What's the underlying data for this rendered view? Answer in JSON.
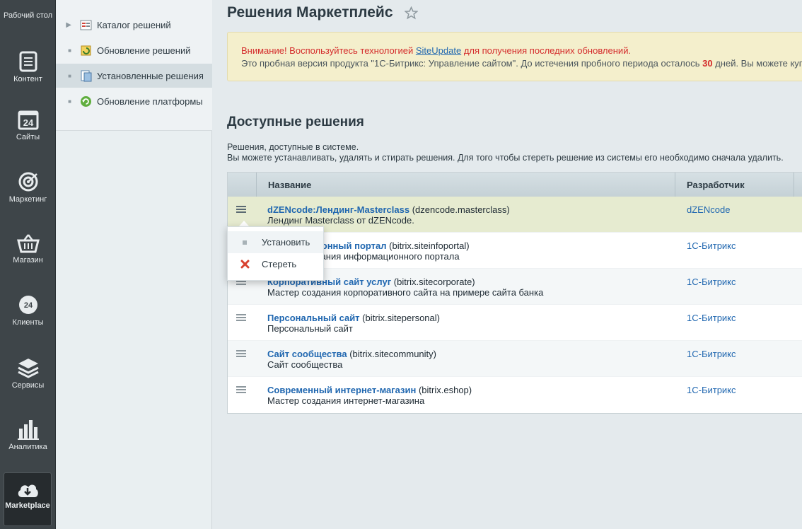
{
  "leftbar": {
    "items": [
      {
        "label": "Рабочий стол",
        "icon": "desktop-icon"
      },
      {
        "label": "Контент",
        "icon": "content-icon"
      },
      {
        "label": "Сайты",
        "icon": "sites-icon"
      },
      {
        "label": "Маркетинг",
        "icon": "marketing-target-icon"
      },
      {
        "label": "Магазин",
        "icon": "shop-basket-icon"
      },
      {
        "label": "Клиенты",
        "icon": "clients-24-icon"
      },
      {
        "label": "Сервисы",
        "icon": "services-layers-icon"
      },
      {
        "label": "Аналитика",
        "icon": "analytics-bars-icon"
      },
      {
        "label": "Marketplace",
        "icon": "cloud-download-icon",
        "active": true
      }
    ]
  },
  "tree": {
    "items": [
      {
        "label": "Каталог решений",
        "icon": "catalog-icon"
      },
      {
        "label": "Обновление решений",
        "icon": "update-solutions-icon"
      },
      {
        "label": "Установленные решения",
        "icon": "installed-solutions-icon",
        "selected": true
      },
      {
        "label": "Обновление платформы",
        "icon": "platform-update-icon"
      }
    ]
  },
  "page": {
    "title": "Решения Маркетплейс"
  },
  "notice": {
    "warn_prefix": "Внимание! Воспользуйтесь технологией ",
    "warn_link": "SiteUpdate",
    "warn_suffix": " для получения последних обновлений.",
    "trial_prefix": "Это пробная версия продукта \"1С-Битрикс: Управление сайтом\". До истечения пробного периода осталось ",
    "trial_days": "30",
    "trial_suffix": " дней. Вы можете куп"
  },
  "section": {
    "title": "Доступные решения",
    "desc_line1": "Решения, доступные в системе.",
    "desc_line2": "Вы можете устанавливать, удалять и стирать решения. Для того чтобы стереть решение из системы его необходимо сначала удалить."
  },
  "grid": {
    "columns": {
      "name": "Название",
      "developer": "Разработчик"
    },
    "rows": [
      {
        "title": "dZENcode:Лендинг-Masterclass",
        "code": " (dzencode.masterclass)",
        "desc": "Лендинг Masterclass от dZENcode.",
        "developer": "dZENcode"
      },
      {
        "title": "Информационный портал",
        "code": " (bitrix.siteinfoportal)",
        "desc": "Мастер создания информационного портала",
        "developer": "1С-Битрикс"
      },
      {
        "title": "Корпоративный сайт услуг",
        "code": " (bitrix.sitecorporate)",
        "desc": "Мастер создания корпоративного сайта на примере сайта банка",
        "developer": "1С-Битрикс"
      },
      {
        "title": "Персональный сайт",
        "code": " (bitrix.sitepersonal)",
        "desc": "Персональный сайт",
        "developer": "1С-Битрикс"
      },
      {
        "title": "Сайт сообщества",
        "code": " (bitrix.sitecommunity)",
        "desc": "Сайт сообщества",
        "developer": "1С-Битрикс"
      },
      {
        "title": "Современный интернет-магазин",
        "code": " (bitrix.eshop)",
        "desc": "Мастер создания интернет-магазина",
        "developer": "1С-Битрикс"
      }
    ]
  },
  "context_menu": {
    "install": "Установить",
    "erase": "Стереть"
  },
  "colors": {
    "link": "#2067b0",
    "warning": "#d42b2b",
    "notice_bg": "#f4efcc",
    "leftbar_bg": "#3e4549"
  }
}
